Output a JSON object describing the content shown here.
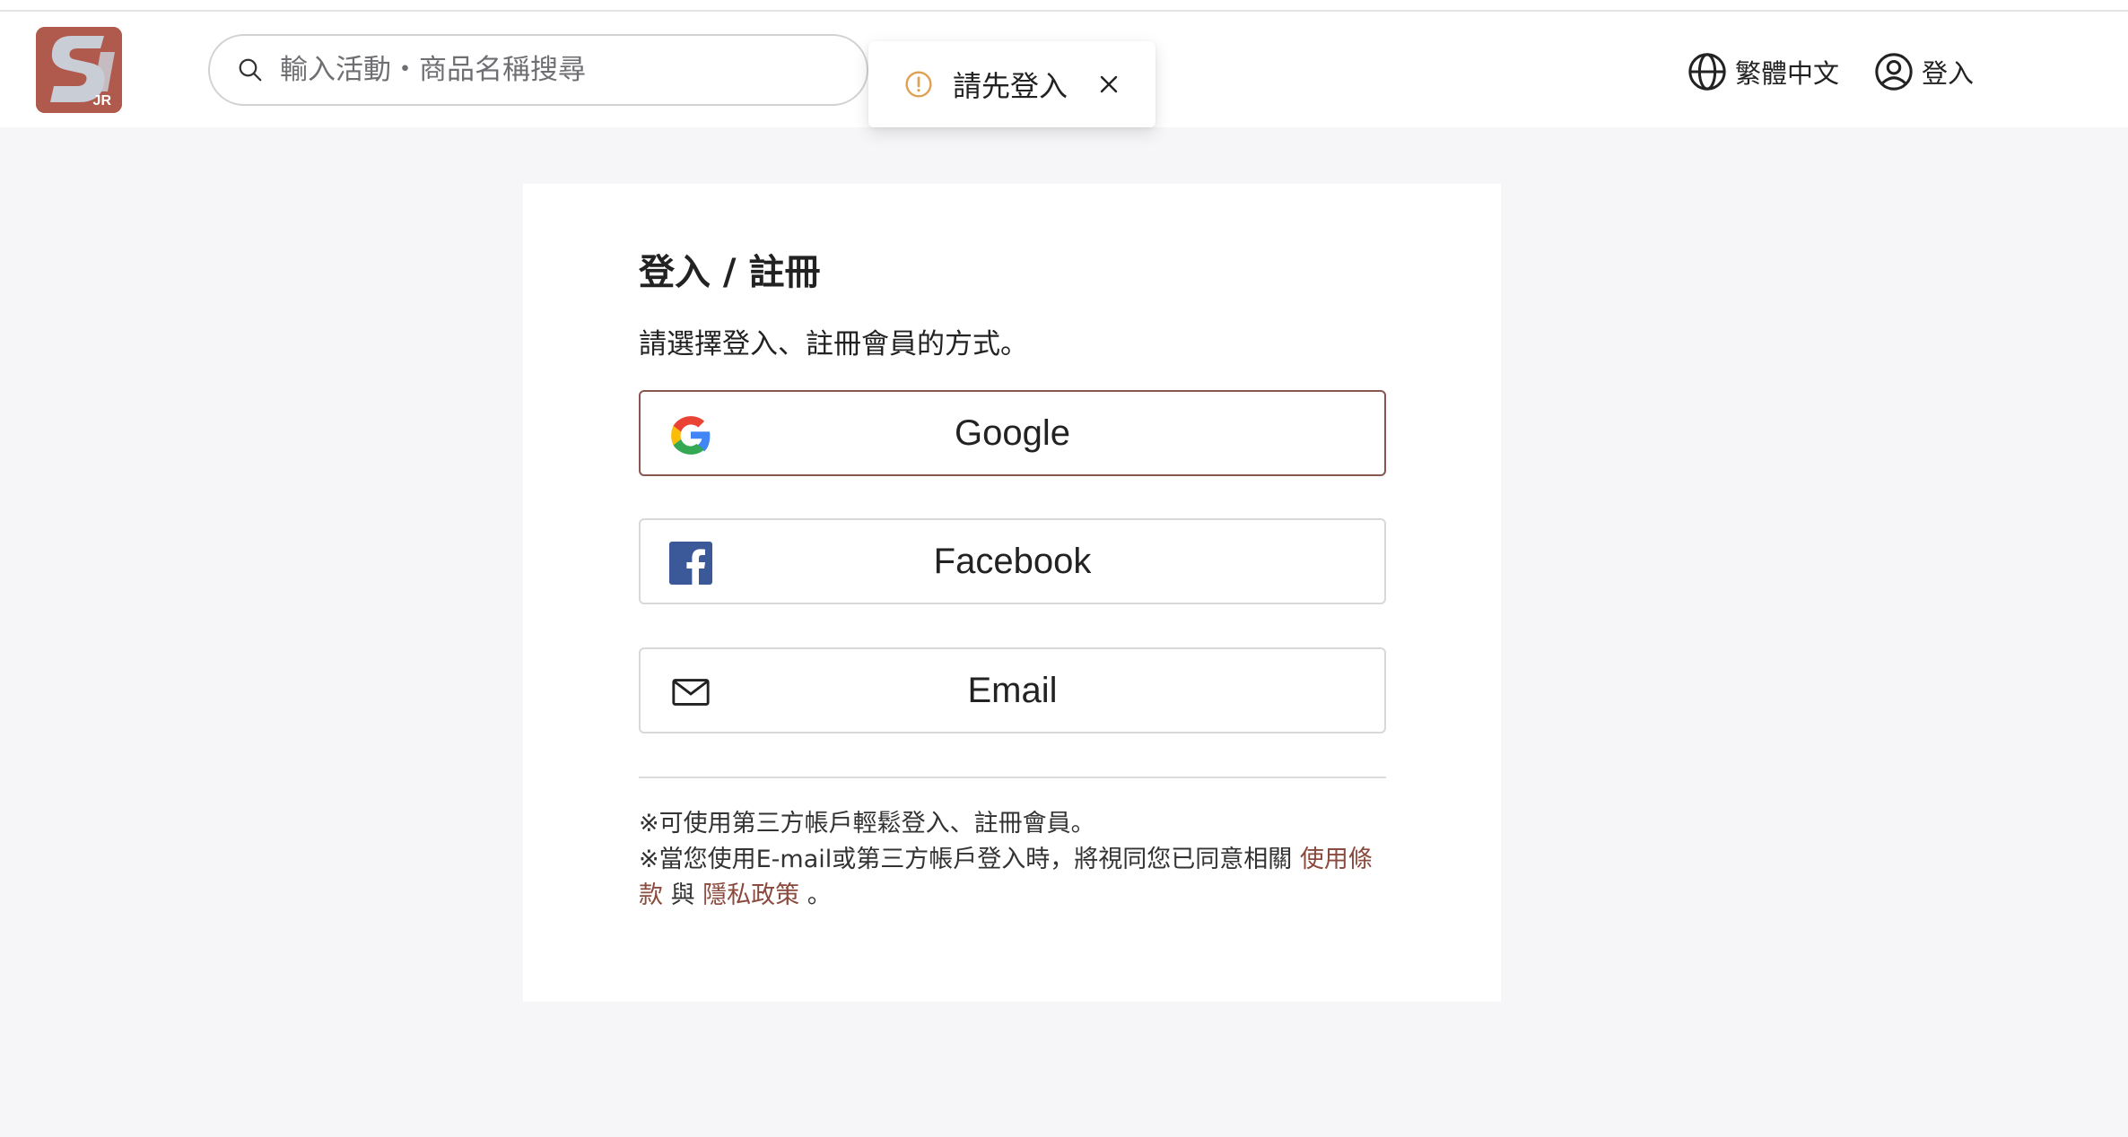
{
  "header": {
    "search_placeholder": "輸入活動・商品名稱搜尋",
    "language_label": "繁體中文",
    "login_label": "登入",
    "logo_text": "JR"
  },
  "toast": {
    "message": "請先登入"
  },
  "login_card": {
    "title": "登入 / 註冊",
    "subtitle": "請選擇登入、註冊會員的方式。",
    "google_label": "Google",
    "facebook_label": "Facebook",
    "email_label": "Email",
    "note_line1": "※可使用第三方帳戶輕鬆登入、註冊會員。",
    "note_line2_prefix": "※當您使用E-mail或第三方帳戶登入時，將視同您已同意相關 ",
    "terms_link": "使用條款",
    "and_text": " 與 ",
    "privacy_link": "隱私政策",
    "period": " 。"
  },
  "colors": {
    "accent_brown": "#8b4a3e",
    "logo_bg": "#b05a4e",
    "warning": "#e0a052",
    "facebook_blue": "#3b5998"
  }
}
